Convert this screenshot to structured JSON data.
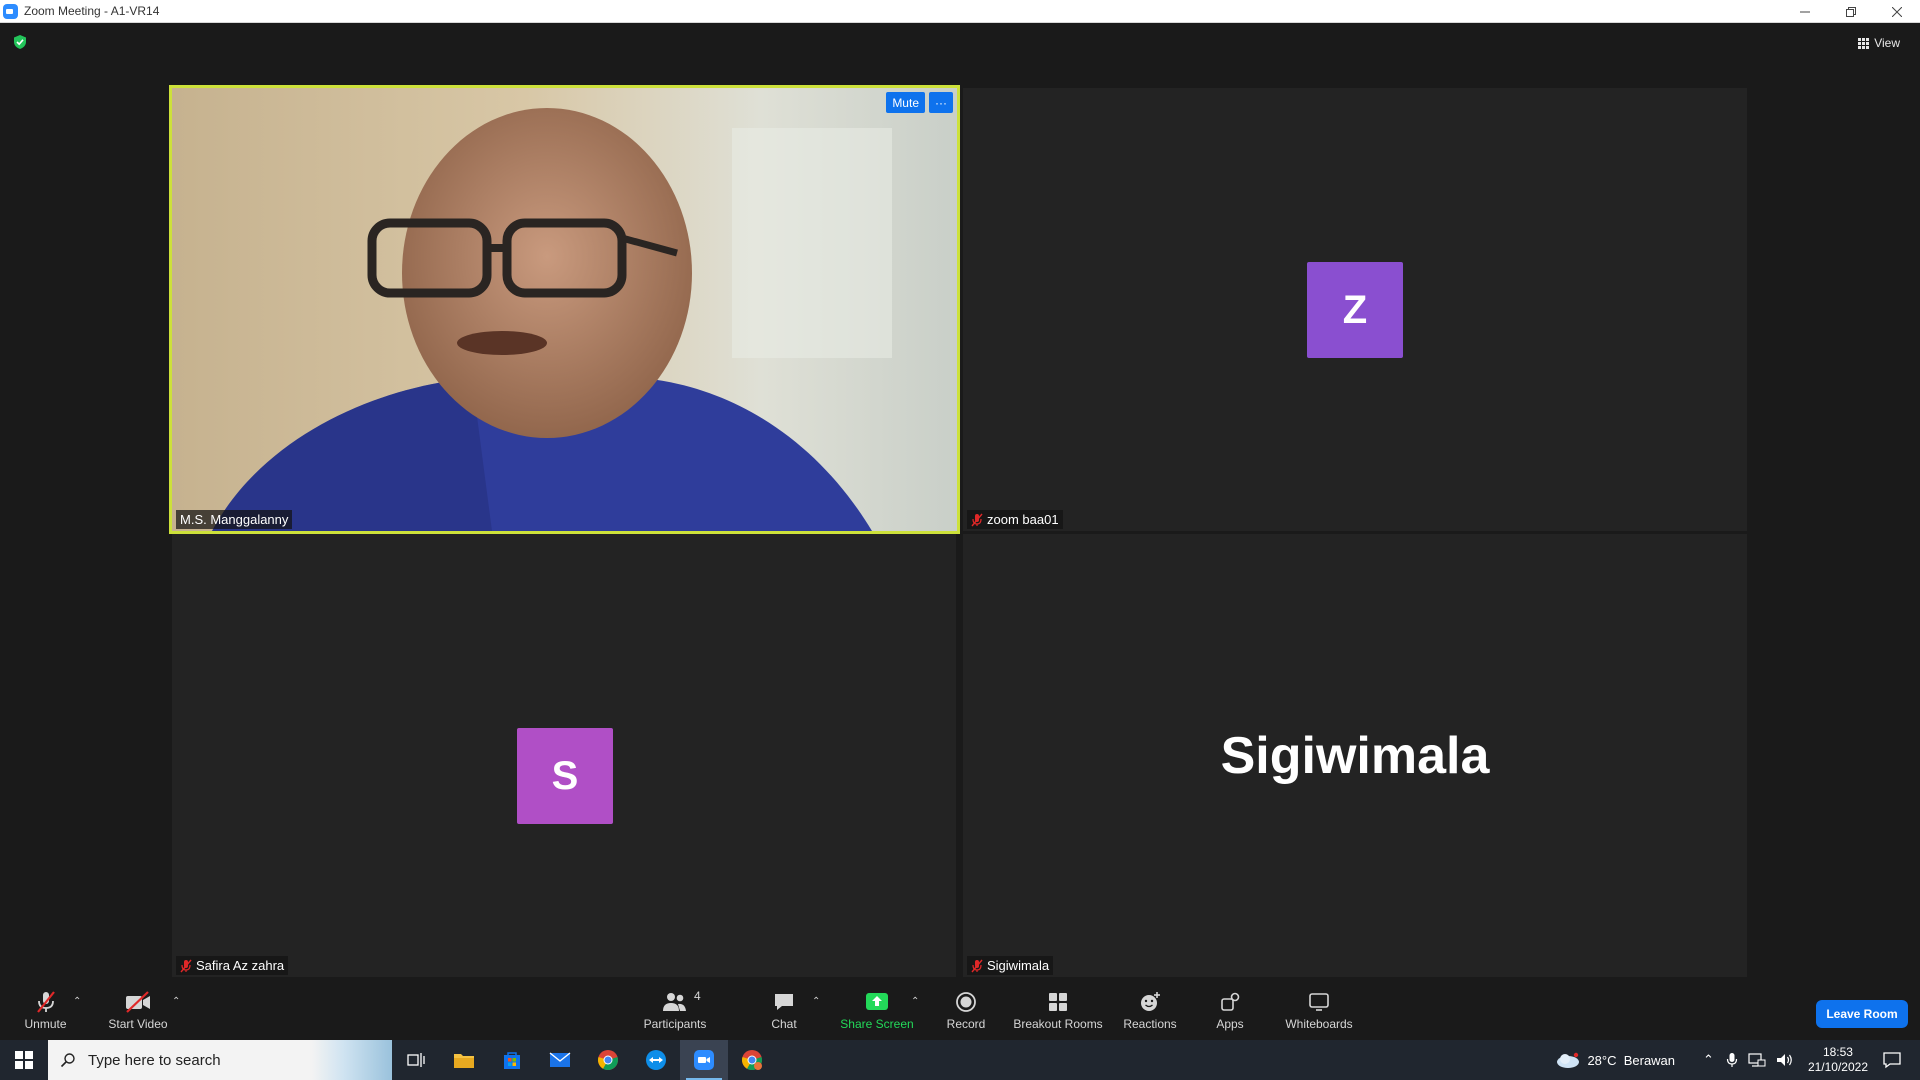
{
  "window": {
    "title": "Zoom Meeting - A1-VR14",
    "controls": [
      "minimize",
      "restore",
      "close"
    ]
  },
  "meeting": {
    "view_label": "View",
    "tiles": [
      {
        "name": "M.S. Manggalanny",
        "type": "video",
        "active_speaker": true,
        "muted": false,
        "buttons": {
          "mute": "Mute",
          "more": "···"
        }
      },
      {
        "name": "zoom baa01",
        "type": "avatar",
        "avatar_letter": "Z",
        "avatar_color": "#8a4fd0",
        "muted": true
      },
      {
        "name": "Safira Az zahra",
        "type": "avatar",
        "avatar_letter": "S",
        "avatar_color": "#b04fc6",
        "muted": true
      },
      {
        "name": "Sigiwimala",
        "type": "name",
        "display_name": "Sigiwimala",
        "muted": true
      }
    ]
  },
  "toolbar": {
    "unmute": "Unmute",
    "start_video": "Start Video",
    "participants": "Participants",
    "participants_count": "4",
    "chat": "Chat",
    "share_screen": "Share Screen",
    "record": "Record",
    "breakout_rooms": "Breakout Rooms",
    "reactions": "Reactions",
    "apps": "Apps",
    "whiteboards": "Whiteboards",
    "leave": "Leave Room"
  },
  "taskbar": {
    "search_placeholder": "Type here to search",
    "weather": "28°C  Berawan",
    "time": "18:53",
    "date": "21/10/2022"
  },
  "colors": {
    "active_speaker_border": "#cde13a",
    "accent_blue": "#0e72ed",
    "share_green": "#23d959",
    "mic_off_red": "#e02828"
  }
}
